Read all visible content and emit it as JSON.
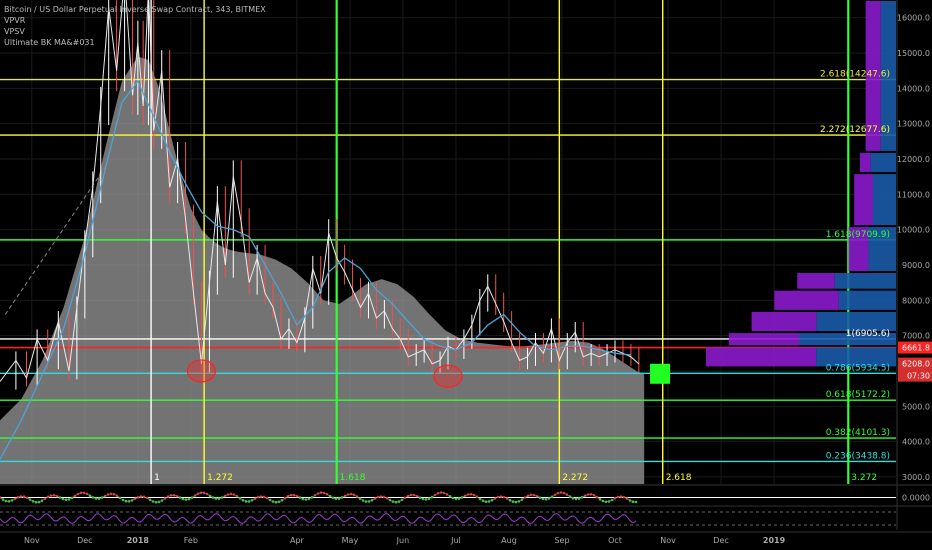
{
  "legend": {
    "symbol": "Bitcoin / US Dollar Perpetual Inverse Swap Contract, 343, BITMEX",
    "indicators": [
      "VPVR",
      "VPSV",
      "Ultimate BK MA&#031"
    ]
  },
  "colors": {
    "background": "#000000",
    "candle_up": "#26a69a",
    "candle_down": "#ef5350",
    "volume_area": "#9a9a9a",
    "ma_line": "#4fa3d6",
    "fib_yellow": "#ffff33",
    "fib_green": "#33ff33",
    "fib_cyan": "#33dddd",
    "red_line": "#ff2222",
    "white_line": "#ffffff",
    "vp_purple": "#8a1acc",
    "vp_blue": "#1a5aa8",
    "target_box": "#22ff22"
  },
  "chart_data": {
    "type": "line",
    "title": "Bitcoin / US Dollar Perpetual Inverse Swap Contract, 343, BITMEX",
    "y_axis": {
      "min": 2800,
      "max": 16500,
      "ticks": [
        3000,
        4000,
        5000,
        6000,
        7000,
        8000,
        9000,
        10000,
        11000,
        12000,
        13000,
        14000,
        15000,
        16000
      ],
      "tick_labels": [
        "3000.0",
        "4000.0",
        "5000.0",
        "6000.0",
        "7000.0",
        "8000.0",
        "9000.0",
        "10000.0",
        "11000.0",
        "12000.0",
        "13000.0",
        "14000.0",
        "15000.0",
        "16000.0"
      ]
    },
    "x_axis": {
      "labels": [
        {
          "text": "Nov",
          "t": 1.0
        },
        {
          "text": "Dec",
          "t": 2.0
        },
        {
          "text": "2018",
          "t": 3.0
        },
        {
          "text": "Feb",
          "t": 4.0
        },
        {
          "text": "Apr",
          "t": 6.0
        },
        {
          "text": "May",
          "t": 7.0
        },
        {
          "text": "Jun",
          "t": 8.0
        },
        {
          "text": "Jul",
          "t": 9.0
        },
        {
          "text": "Aug",
          "t": 10.0
        },
        {
          "text": "Sep",
          "t": 11.0
        },
        {
          "text": "Oct",
          "t": 12.0
        },
        {
          "text": "Nov",
          "t": 13.0
        },
        {
          "text": "Dec",
          "t": 14.0
        },
        {
          "text": "2019",
          "t": 15.0
        }
      ],
      "t_range": [
        0.4,
        17.3
      ]
    },
    "price_series": {
      "name": "",
      "t": [
        0.4,
        0.7,
        0.9,
        1.1,
        1.3,
        1.5,
        1.7,
        1.85,
        2.0,
        2.15,
        2.3,
        2.45,
        2.6,
        2.75,
        2.9,
        3.0,
        3.1,
        3.2,
        3.3,
        3.45,
        3.6,
        3.75,
        3.9,
        4.05,
        4.2,
        4.35,
        4.5,
        4.65,
        4.8,
        4.95,
        5.1,
        5.25,
        5.4,
        5.55,
        5.7,
        5.85,
        6.0,
        6.15,
        6.3,
        6.45,
        6.6,
        6.75,
        6.9,
        7.05,
        7.2,
        7.35,
        7.5,
        7.65,
        7.8,
        7.95,
        8.1,
        8.25,
        8.4,
        8.55,
        8.7,
        8.85,
        9.0,
        9.15,
        9.3,
        9.45,
        9.6,
        9.75,
        9.9,
        10.05,
        10.2,
        10.35,
        10.5,
        10.65,
        10.8,
        10.95,
        11.1,
        11.25,
        11.4,
        11.55,
        11.7,
        11.85,
        12.0,
        12.15,
        12.3,
        12.45
      ],
      "values": [
        5700,
        6300,
        5800,
        6900,
        6300,
        7400,
        6000,
        7800,
        9600,
        11200,
        13500,
        16300,
        14500,
        17200,
        13800,
        15300,
        13500,
        16800,
        12800,
        14500,
        11200,
        12000,
        10300,
        8200,
        6200,
        8500,
        10800,
        9000,
        11500,
        10200,
        8500,
        9200,
        8200,
        7800,
        6900,
        7200,
        6800,
        7500,
        8900,
        8200,
        9900,
        9200,
        8800,
        8300,
        7800,
        8200,
        7500,
        7700,
        7200,
        6900,
        6400,
        6500,
        6600,
        6200,
        6300,
        6700,
        6600,
        6900,
        7300,
        8000,
        8400,
        7900,
        7400,
        6800,
        6300,
        6400,
        6800,
        6500,
        7200,
        6300,
        6800,
        7100,
        6400,
        6500,
        6400,
        6500,
        6600,
        6500,
        6400,
        6200
      ]
    },
    "volume_area_series": {
      "name": "",
      "t": [
        0.4,
        0.8,
        1.2,
        1.6,
        2.0,
        2.4,
        2.7,
        3.0,
        3.2,
        3.4,
        3.6,
        3.8,
        4.0,
        4.2,
        4.4,
        4.6,
        4.8,
        5.0,
        5.3,
        5.6,
        5.9,
        6.2,
        6.5,
        6.8,
        7.0,
        7.3,
        7.6,
        7.9,
        8.2,
        8.5,
        8.8,
        9.1,
        9.4,
        9.7,
        10.0,
        10.3,
        10.6,
        10.9,
        11.2,
        11.5,
        11.8,
        12.1,
        12.4,
        12.55
      ],
      "values": [
        4600,
        5200,
        6300,
        7800,
        9800,
        12400,
        14200,
        14900,
        14800,
        14000,
        12800,
        11600,
        10600,
        10000,
        9700,
        9500,
        9400,
        9350,
        9300,
        9150,
        8900,
        8500,
        8000,
        7900,
        8100,
        8450,
        8600,
        8450,
        8100,
        7600,
        7150,
        6900,
        6800,
        6750,
        6700,
        6700,
        6750,
        6800,
        6850,
        6800,
        6600,
        6300,
        6000,
        5900
      ]
    },
    "ma_series": {
      "name": "",
      "t": [
        0.4,
        0.8,
        1.2,
        1.6,
        2.0,
        2.4,
        2.7,
        3.0,
        3.3,
        3.6,
        3.9,
        4.2,
        4.5,
        4.8,
        5.1,
        5.4,
        5.7,
        6.0,
        6.3,
        6.6,
        6.9,
        7.2,
        7.5,
        7.8,
        8.1,
        8.4,
        8.7,
        9.0,
        9.3,
        9.6,
        9.9,
        10.2,
        10.5,
        10.8,
        11.1,
        11.4,
        11.7,
        12.0,
        12.3
      ],
      "values": [
        3500,
        4600,
        5900,
        7200,
        9300,
        11800,
        13600,
        14200,
        13200,
        12200,
        11300,
        10500,
        10100,
        10000,
        9800,
        9000,
        8200,
        7300,
        7800,
        8800,
        9200,
        8900,
        8300,
        7900,
        7400,
        6900,
        6700,
        6600,
        6800,
        7300,
        7600,
        7100,
        6700,
        6600,
        6700,
        6700,
        6600,
        6500,
        6450
      ]
    },
    "horizontal_levels": [
      {
        "label": "2.618(14247.6)",
        "value": 14247.6,
        "color": "#e8e83a"
      },
      {
        "label": "2.272(12677.6)",
        "value": 12677.6,
        "color": "#ffff33"
      },
      {
        "label": "1.618(9709.9)",
        "value": 9709.9,
        "color": "#33ff33"
      },
      {
        "label": "1(6905.6)",
        "value": 6905.6,
        "color": "#ffffff"
      },
      {
        "label": "0.786(5934.5)",
        "value": 5934.5,
        "color": "#33dddd"
      },
      {
        "label": "0.618(5172.2)",
        "value": 5172.2,
        "color": "#33ff33"
      },
      {
        "label": "0.382(4101.3)",
        "value": 4101.3,
        "color": "#33ff33"
      },
      {
        "label": "0.236(3438.8)",
        "value": 3438.8,
        "color": "#33dddd"
      }
    ],
    "red_level": {
      "value": 6661.8,
      "label": "6661.8"
    },
    "current_price": {
      "value": 6208.0,
      "label": "6208.0"
    },
    "countdown": "07:30",
    "vertical_lines": [
      {
        "t": 3.25,
        "label": "1",
        "color": "#ffffff"
      },
      {
        "t": 4.25,
        "label": "1.272",
        "color": "#ffff33"
      },
      {
        "t": 6.75,
        "label": "1.618",
        "color": "#33ff33"
      },
      {
        "t": 10.95,
        "label": "2.272",
        "color": "#ffff33"
      },
      {
        "t": 12.9,
        "label": "2.618",
        "color": "#ffff33"
      },
      {
        "t": 16.4,
        "label": "3.272",
        "color": "#33ff33"
      }
    ],
    "volume_profile": [
      {
        "price_low": 6100,
        "price_high": 6700,
        "purple": 0.58,
        "blue": 0.42
      },
      {
        "price_low": 6700,
        "price_high": 7100,
        "purple": 0.42,
        "blue": 0.58
      },
      {
        "price_low": 7100,
        "price_high": 7700,
        "purple": 0.45,
        "blue": 0.55
      },
      {
        "price_low": 7700,
        "price_high": 8300,
        "purple": 0.53,
        "blue": 0.47
      },
      {
        "price_low": 8300,
        "price_high": 8800,
        "purple": 0.38,
        "blue": 0.62
      },
      {
        "price_low": 8800,
        "price_high": 10100,
        "purple": 0.42,
        "blue": 0.58
      },
      {
        "price_low": 10100,
        "price_high": 11600,
        "purple": 0.45,
        "blue": 0.55
      },
      {
        "price_low": 11600,
        "price_high": 12200,
        "purple": 0.3,
        "blue": 0.7
      },
      {
        "price_low": 12200,
        "price_high": 16500,
        "purple": 0.5,
        "blue": 0.5
      }
    ],
    "vp_max_width_frac": 1.0,
    "annotations": [
      {
        "type": "red_circle",
        "t": 4.2,
        "value": 6000
      },
      {
        "type": "red_circle",
        "t": 8.85,
        "value": 5850
      }
    ],
    "target_box": {
      "t": 12.85,
      "value": 5920
    },
    "oscillator_value": "0.0000",
    "grid": true
  }
}
